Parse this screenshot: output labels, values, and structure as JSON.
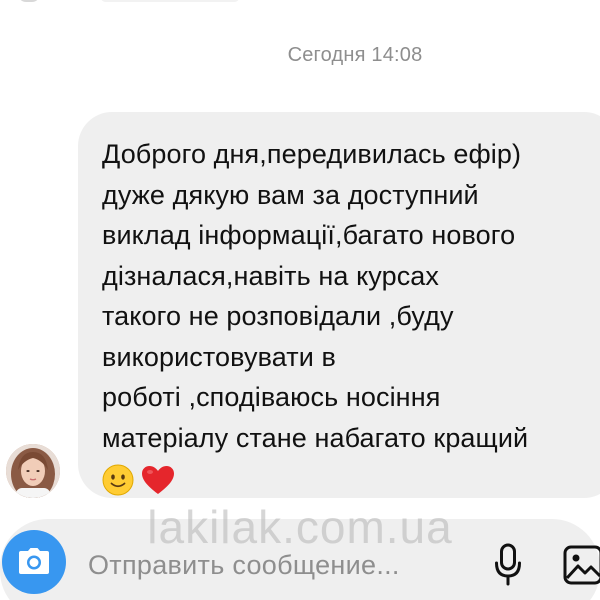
{
  "chat": {
    "timestamp": "Сегодня 14:08",
    "message": {
      "lines": [
        "Доброго дня,передивилась ефір)",
        "дуже дякую вам за доступний",
        "виклад інформації,багато нового",
        "дізналася,навіть на курсах",
        "такого не розповідали ,буду",
        "використовувати в",
        "роботі ,сподіваюсь носіння",
        "матеріалу стане набагато кращий"
      ],
      "emoji": [
        "🙂",
        "❤"
      ]
    }
  },
  "watermark": "lakilak.com.ua",
  "composer": {
    "placeholder": "Отправить сообщение...",
    "icons": [
      "camera-icon",
      "microphone-icon",
      "gallery-icon"
    ],
    "accent_color": "#3897f0"
  }
}
